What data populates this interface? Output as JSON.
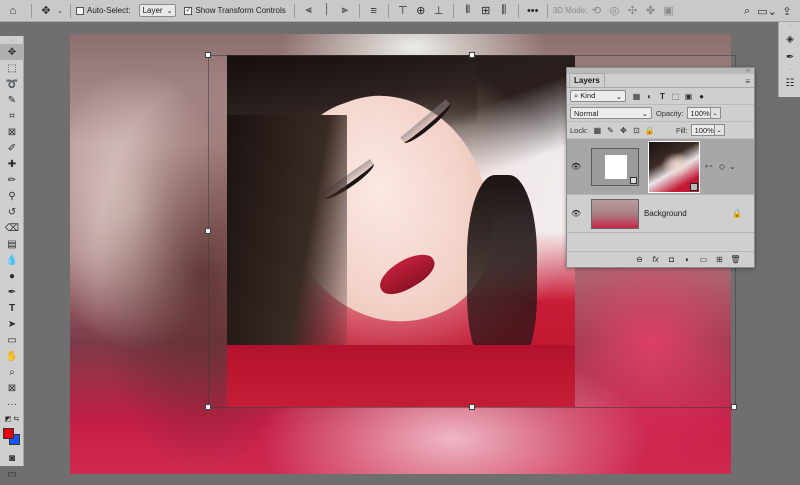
{
  "options_bar": {
    "auto_select_label": "Auto-Select:",
    "auto_select_target": "Layer",
    "show_transform_label": "Show Transform Controls",
    "three_d_mode_label": "3D Mode:"
  },
  "colors": {
    "foreground": "#e8000b",
    "background": "#1557ff"
  },
  "layers_panel": {
    "title": "Layers",
    "filter_kind": "Kind",
    "blend_mode": "Normal",
    "opacity_label": "Opacity:",
    "opacity_value": "100%",
    "lock_label": "Lock:",
    "fill_label": "Fill:",
    "fill_value": "100%",
    "layers": [
      {
        "name": "",
        "type": "smart-object-with-mask",
        "selected": true
      },
      {
        "name": "Background",
        "type": "background",
        "locked": true
      }
    ]
  }
}
